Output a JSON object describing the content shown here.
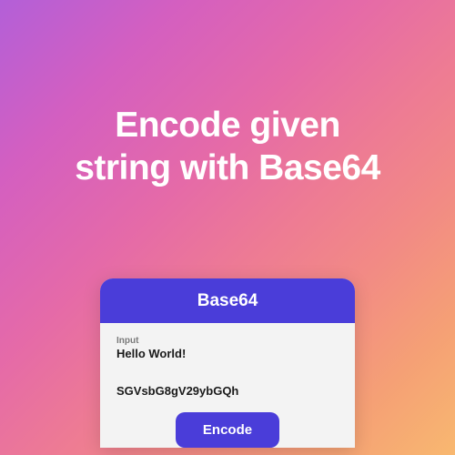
{
  "heading": {
    "line1": "Encode given",
    "line2": "string with Base64"
  },
  "card": {
    "title": "Base64",
    "input_label": "Input",
    "input_value": "Hello World!",
    "output_value": "SGVsbG8gV29ybGQh",
    "encode_button_label": "Encode"
  }
}
